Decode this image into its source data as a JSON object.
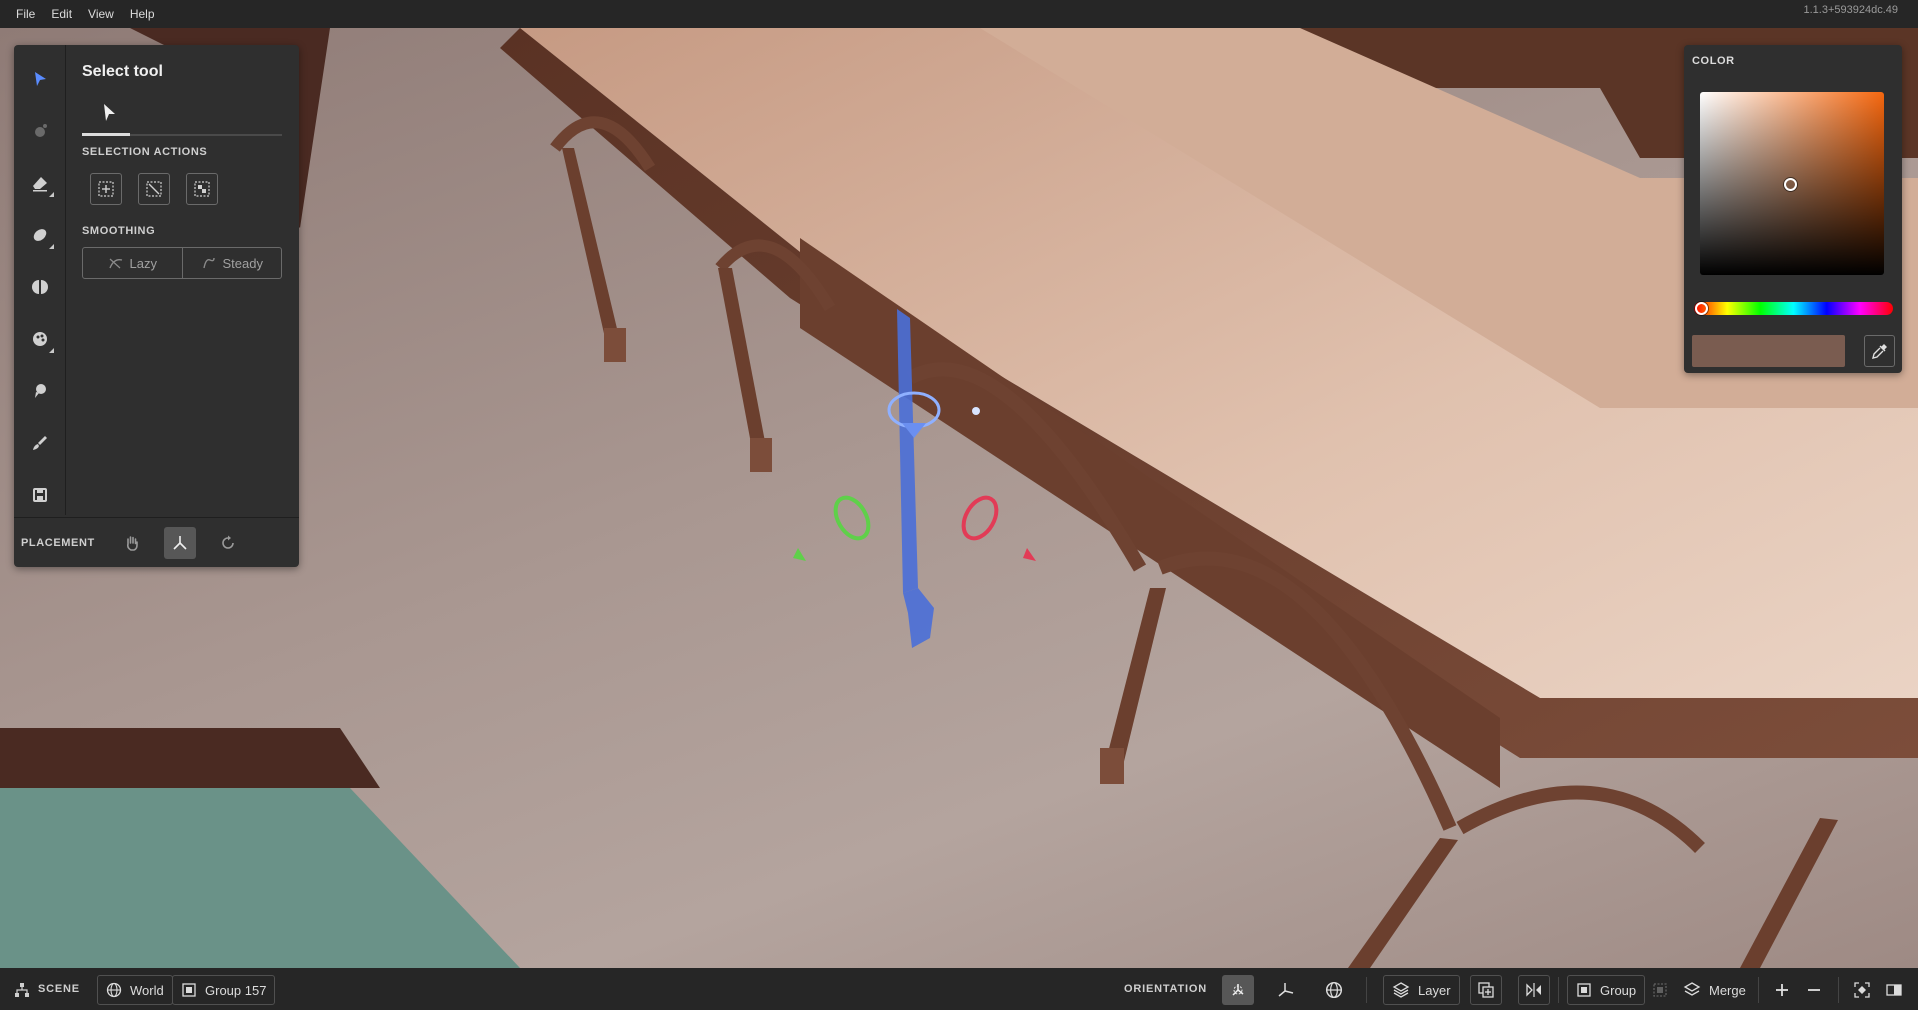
{
  "menubar": {
    "items": [
      "File",
      "Edit",
      "View",
      "Help"
    ],
    "version": "1.1.3+593924dc.49"
  },
  "tool_panel": {
    "title": "Select tool",
    "tools": [
      {
        "name": "select",
        "icon": "select-arrow-icon"
      },
      {
        "name": "paint",
        "icon": "paint-spray-icon"
      },
      {
        "name": "erase",
        "icon": "eraser-icon"
      },
      {
        "name": "move",
        "icon": "push-pull-icon"
      },
      {
        "name": "mirror",
        "icon": "mirror-half-icon"
      },
      {
        "name": "fill",
        "icon": "fill-palette-icon"
      },
      {
        "name": "clone",
        "icon": "smudge-icon"
      },
      {
        "name": "brush",
        "icon": "brush-icon"
      },
      {
        "name": "save",
        "icon": "save-icon"
      }
    ],
    "selection_actions_label": "SELECTION ACTIONS",
    "smoothing_label": "SMOOTHING",
    "smoothing_options": {
      "lazy": "Lazy",
      "steady": "Steady"
    },
    "placement_label": "PLACEMENT"
  },
  "color_panel": {
    "title": "COLOR",
    "current_color": "#7a5c50",
    "hue_color": "#f5670f"
  },
  "bottombar": {
    "scene_label": "SCENE",
    "world_label": "World",
    "group_label": "Group 157",
    "orientation_label": "ORIENTATION",
    "layer_label": "Layer",
    "group_action_label": "Group",
    "merge_label": "Merge"
  }
}
